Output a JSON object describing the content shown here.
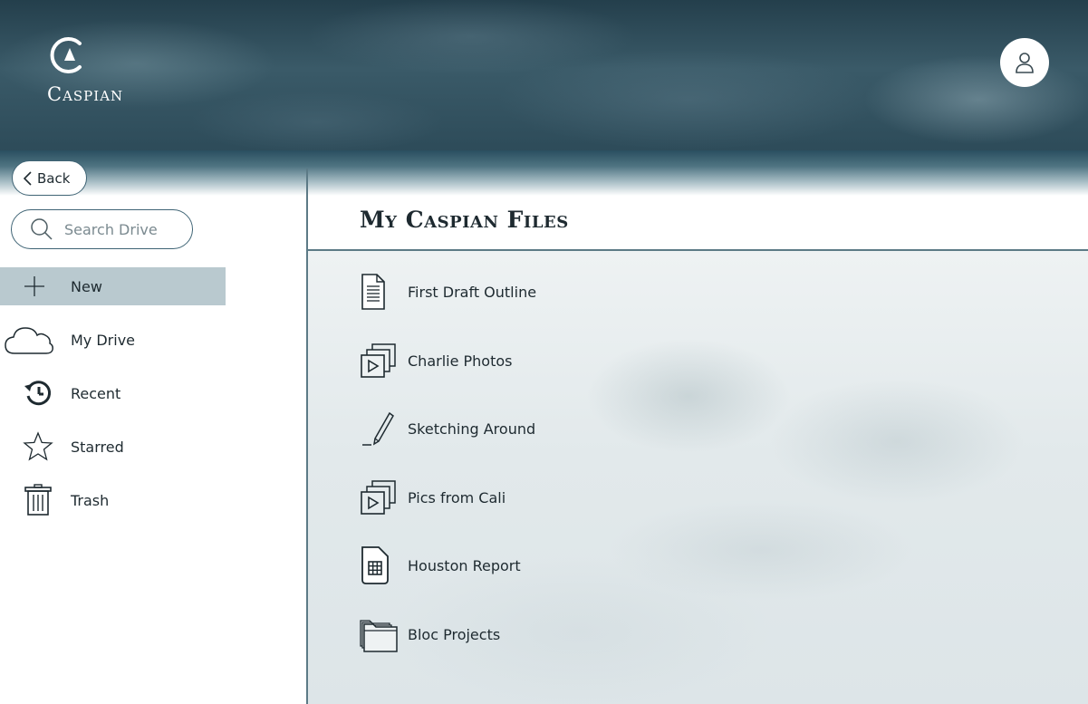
{
  "brand": {
    "name": "Caspian"
  },
  "header": {
    "account_icon": "user-icon"
  },
  "sidebar": {
    "back_label": "Back",
    "search_placeholder": "Search Drive",
    "items": [
      {
        "label": "New",
        "icon": "plus-icon"
      },
      {
        "label": "My Drive",
        "icon": "cloud-icon"
      },
      {
        "label": "Recent",
        "icon": "history-icon"
      },
      {
        "label": "Starred",
        "icon": "star-icon"
      },
      {
        "label": "Trash",
        "icon": "trash-icon"
      }
    ]
  },
  "main": {
    "title": "My Caspian Files",
    "files": [
      {
        "name": "First Draft Outline",
        "icon": "document-icon"
      },
      {
        "name": "Charlie Photos",
        "icon": "media-stack-icon"
      },
      {
        "name": "Sketching Around",
        "icon": "pencil-icon"
      },
      {
        "name": "Pics from Cali",
        "icon": "media-stack-icon"
      },
      {
        "name": "Houston Report",
        "icon": "spreadsheet-icon"
      },
      {
        "name": "Bloc Projects",
        "icon": "folder-stack-icon"
      }
    ]
  },
  "colors": {
    "accent": "#3f6475",
    "selected_bg": "#b9c9cf",
    "header_dark": "#243f4c"
  }
}
